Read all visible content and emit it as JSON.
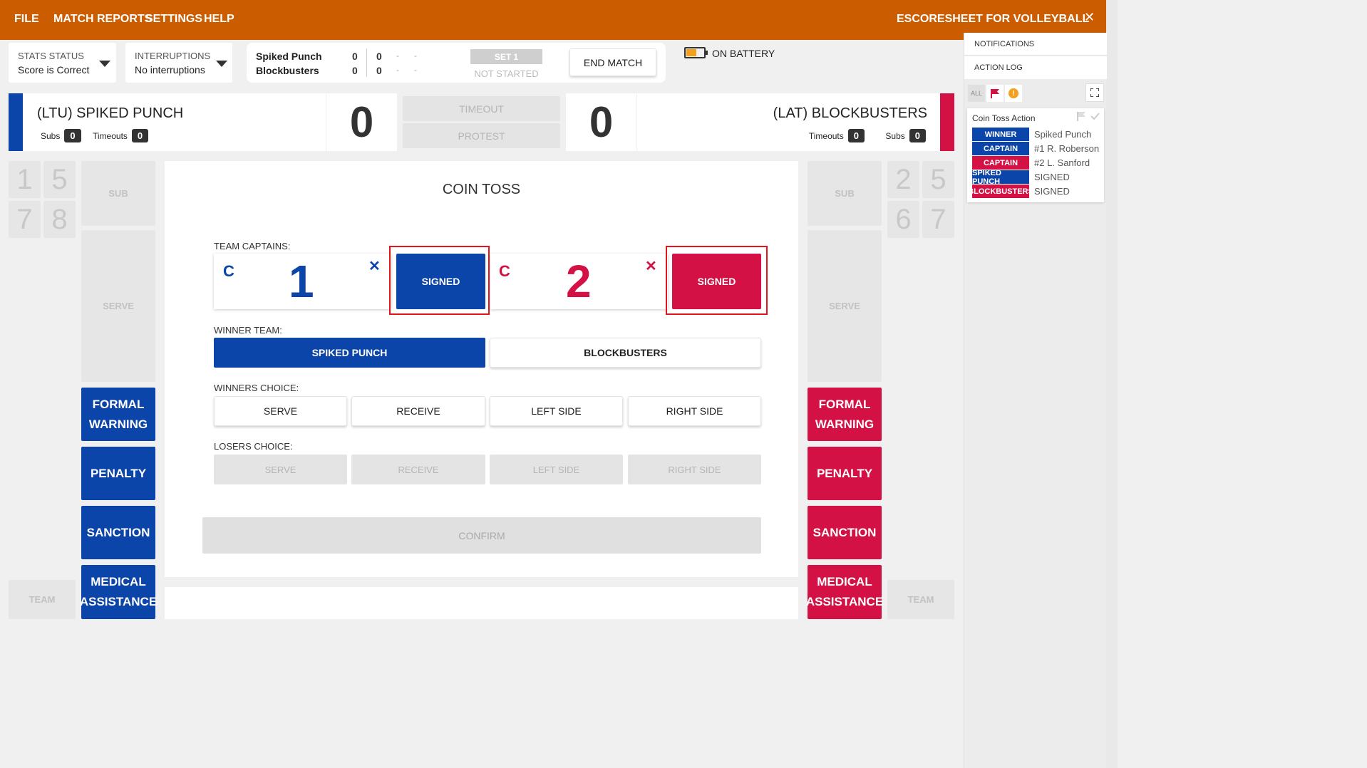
{
  "menu": {
    "file": "FILE",
    "match": "MATCH",
    "reports": "REPORTS",
    "settings": "SETTINGS",
    "help": "HELP",
    "app_title": "ESCORESHEET FOR VOLLEYBALL",
    "minimize": "_",
    "close": "✕"
  },
  "status": {
    "stats_label": "STATS STATUS",
    "stats_value": "Score is Correct",
    "interruptions_label": "INTERRUPTIONS",
    "interruptions_value": "No interruptions"
  },
  "scoreline": {
    "team1": "Spiked Punch",
    "team2": "Blockbusters",
    "t1_sets": "0",
    "t1_points": "0",
    "t2_sets": "0",
    "t2_points": "0",
    "dash": "-",
    "set_label": "SET 1",
    "set_state": "NOT STARTED",
    "end_match": "END MATCH"
  },
  "battery": {
    "label": "ON BATTERY"
  },
  "home": {
    "name": "(LTU) SPIKED PUNCH",
    "subs_label": "Subs",
    "subs": "0",
    "timeouts_label": "Timeouts",
    "timeouts": "0",
    "score": "0"
  },
  "away": {
    "name": "(LAT) BLOCKBUSTERS",
    "subs_label": "Subs",
    "subs": "0",
    "timeouts_label": "Timeouts",
    "timeouts": "0",
    "score": "0"
  },
  "center_buttons": {
    "timeout": "TIMEOUT",
    "protest": "PROTEST"
  },
  "left_panel": {
    "tiles": [
      "1",
      "5",
      "7",
      "8"
    ],
    "sub": "SUB",
    "serve": "SERVE",
    "formal_warning": "FORMAL\nWARNING",
    "penalty": "PENALTY",
    "sanction": "SANCTION",
    "medical": "MEDICAL\nASSISTANCE",
    "team": "TEAM"
  },
  "right_panel": {
    "tiles": [
      "2",
      "5",
      "6",
      "7"
    ],
    "sub": "SUB",
    "serve": "SERVE",
    "formal_warning": "FORMAL\nWARNING",
    "penalty": "PENALTY",
    "sanction": "SANCTION",
    "medical": "MEDICAL\nASSISTANCE",
    "team": "TEAM"
  },
  "coin_toss": {
    "title": "COIN TOSS",
    "captains_label": "TEAM CAPTAINS:",
    "captain_mark": "C",
    "home_captain_no": "1",
    "away_captain_no": "2",
    "remove": "✕",
    "signed": "SIGNED",
    "winner_label": "WINNER TEAM:",
    "winner_home": "SPIKED PUNCH",
    "winner_away": "BLOCKBUSTERS",
    "winners_choice_label": "WINNERS CHOICE:",
    "losers_choice_label": "LOSERS CHOICE:",
    "choices": [
      "SERVE",
      "RECEIVE",
      "LEFT SIDE",
      "RIGHT SIDE"
    ],
    "confirm": "CONFIRM"
  },
  "sidebar": {
    "notifications": "NOTIFICATIONS",
    "action_log": "ACTION LOG",
    "filter_all": "ALL",
    "log_title": "Coin Toss Action",
    "log_rows": [
      {
        "tag": "WINNER",
        "value": "Spiked Punch",
        "color": "#0c45aa"
      },
      {
        "tag": "CAPTAIN",
        "value": "#1 R. Roberson",
        "color": "#0c45aa"
      },
      {
        "tag": "CAPTAIN",
        "value": "#2 L. Sanford",
        "color": "#d31144"
      },
      {
        "tag": "SPIKED PUNCH",
        "value": "SIGNED",
        "color": "#0c45aa"
      },
      {
        "tag": "BLOCKBUSTERS",
        "value": "SIGNED",
        "color": "#d31144"
      }
    ]
  },
  "colors": {
    "topbar": "#cc5c00",
    "home": "#0c45aa",
    "away": "#d31144",
    "highlight": "#e5141b"
  }
}
